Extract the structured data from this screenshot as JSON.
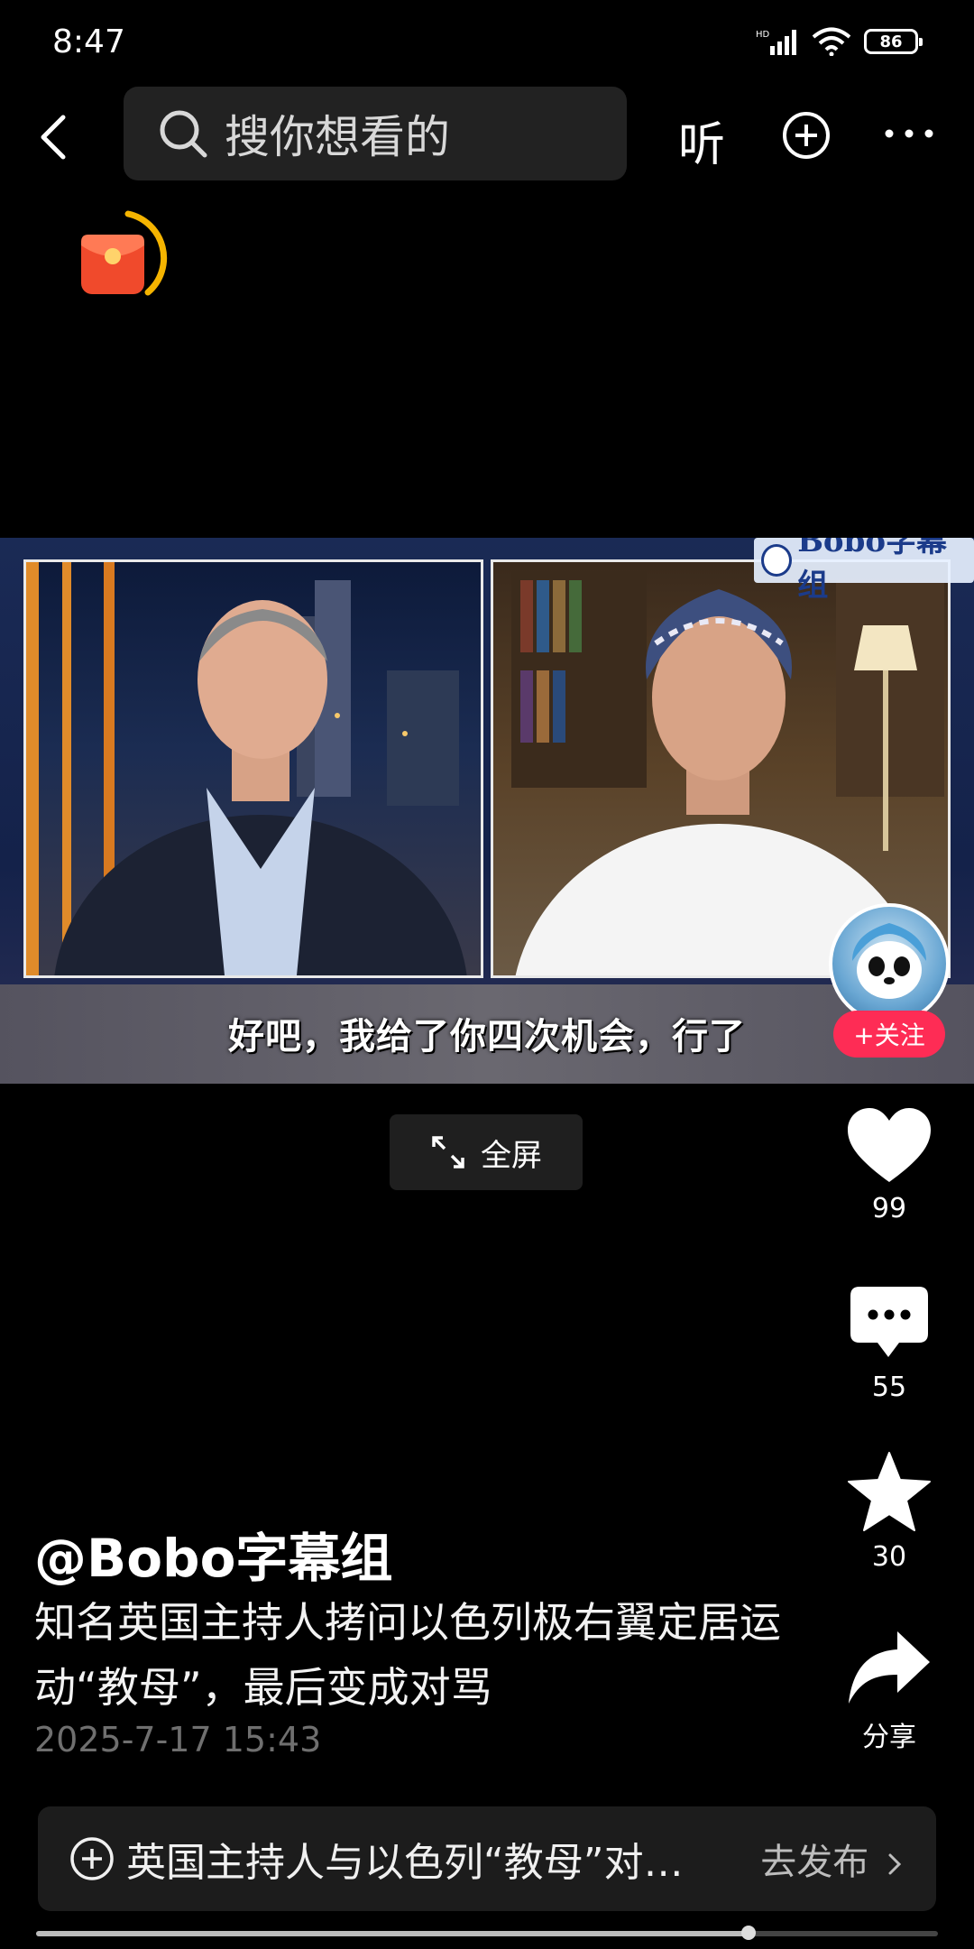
{
  "status_bar": {
    "time": "8:47",
    "network": "HD",
    "battery": "86"
  },
  "header": {
    "search_placeholder": "搜你想看的",
    "listen_label": "听"
  },
  "video": {
    "watermark": "Bobo字幕组",
    "subtitle": "好吧，我给了你四次机会，行了",
    "follow_label": "+关注",
    "fullscreen_label": "全屏",
    "progress": 0.79
  },
  "actions": {
    "like_count": "99",
    "comment_count": "55",
    "favorite_count": "30",
    "share_label": "分享"
  },
  "post": {
    "author": "@Bobo字幕组",
    "description": "知名英国主持人拷问以色列极右翼定居运动“教母”，最后变成对骂",
    "timestamp": "2025-7-17 15:43"
  },
  "bottom_bar": {
    "topic": "英国主持人与以色列“教母”对…",
    "publish_label": "去发布"
  },
  "colors": {
    "accent": "#fe2c55",
    "background": "#000000"
  }
}
